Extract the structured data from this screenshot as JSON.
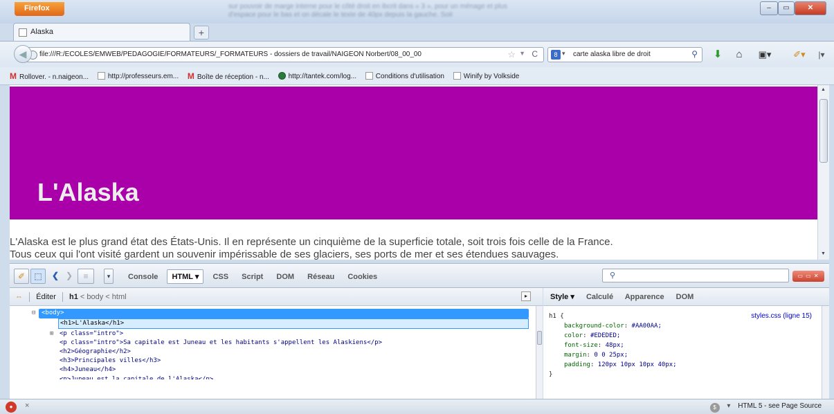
{
  "browser": {
    "menu_button": "Firefox",
    "window_controls": {
      "minimize": "–",
      "maximize": "▭",
      "close": "✕"
    },
    "tab_title": "Alaska",
    "new_tab_symbol": "+",
    "url": "file:///R:/ECOLES/EMWEB/PEDAGOGIE/FORMATEURS/_FORMATEURS - dossiers de travail/NAIGEON Norbert/08_00_00",
    "search_engine_icon": "google-icon",
    "search_text": "carte alaska libre de droit",
    "bookmarks": [
      {
        "label": "Rollover. - n.naigeon...",
        "icon": "gmail-icon"
      },
      {
        "label": "http://professeurs.em...",
        "icon": "page-icon"
      },
      {
        "label": "Boîte de réception - n...",
        "icon": "gmail-icon"
      },
      {
        "label": "http://tantek.com/log...",
        "icon": "globe-icon"
      },
      {
        "label": "Conditions d'utilisation",
        "icon": "page-icon"
      },
      {
        "label": "Winify by Volkside",
        "icon": "page-icon"
      }
    ]
  },
  "page": {
    "heading": "L'Alaska",
    "heading_bg": "#AA00AA",
    "heading_color": "#EDEDED",
    "intro_line1": "L'Alaska est le plus grand état des États-Unis. Il en représente un cinquième de la superficie totale, soit trois fois celle de la France.",
    "intro_line2": "Tous ceux qui l'ont visité gardent un souvenir impérissable de ses glaciers, ses ports de mer et ses étendues sauvages."
  },
  "firebug": {
    "tabs": [
      "Console",
      "HTML ▾",
      "CSS",
      "Script",
      "DOM",
      "Réseau",
      "Cookies"
    ],
    "search_placeholder": "",
    "crumbs": {
      "edit": "Éditer",
      "current": "h1",
      "path": " < body < html"
    },
    "tree": {
      "body": "<body>",
      "h1": "<h1>L'Alaska</h1>",
      "p1_open": "<p class=\"intro\">",
      "p2": "<p class=\"intro\">Sa capitale est Juneau et les habitants s'appellent les Alaskiens</p>",
      "h2": "<h2>Géographie</h2>",
      "h3": "<h3>Principales villes</h3>",
      "h4": "<h4>Juneau</h4>",
      "cut": "<p>Juneau est la capitale de l'Alaska</p>"
    },
    "style_tabs": [
      "Style ▾",
      "Calculé",
      "Apparence",
      "DOM"
    ],
    "css_rule": {
      "selector": "h1 {",
      "source": "styles.css (ligne 15)",
      "props": [
        {
          "name": "background-color",
          "value": "#AA00AA;"
        },
        {
          "name": "color",
          "value": "#EDEDED;"
        },
        {
          "name": "font-size",
          "value": "48px;"
        },
        {
          "name": "margin",
          "value": "0 0 25px;"
        },
        {
          "name": "padding",
          "value": "120px 10px 10px 40px;"
        }
      ],
      "close": "}"
    }
  },
  "status": {
    "close": "×",
    "right": "HTML 5 - see Page Source"
  }
}
